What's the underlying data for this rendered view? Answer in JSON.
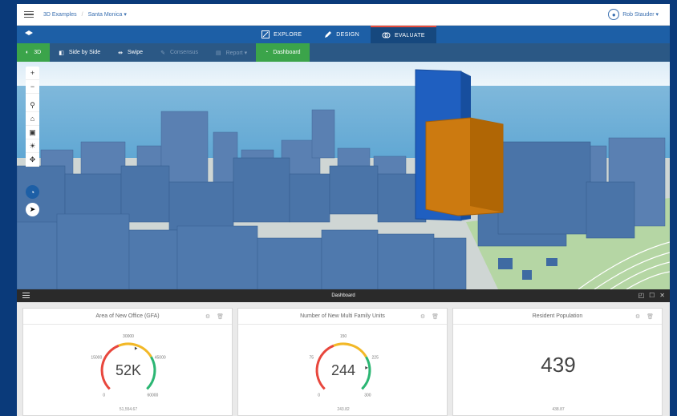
{
  "topbar": {
    "crumb_root": "3D Examples",
    "crumb_sep": "/",
    "crumb_current": "Santa Monica ▾",
    "user_name": "Rob Stauder ▾"
  },
  "nav": {
    "tabs": [
      {
        "label": "EXPLORE",
        "icon": "explore-icon"
      },
      {
        "label": "DESIGN",
        "icon": "pencil-icon"
      },
      {
        "label": "EVALUATE",
        "icon": "evaluate-icon"
      }
    ],
    "active": "EVALUATE"
  },
  "toolbar": {
    "items": [
      {
        "label": "3D",
        "icon": "globe-icon",
        "state": "active"
      },
      {
        "label": "Side by Side",
        "icon": "split-icon",
        "state": "normal"
      },
      {
        "label": "Swipe",
        "icon": "swipe-icon",
        "state": "normal"
      },
      {
        "label": "Consensus",
        "icon": "consensus-icon",
        "state": "disabled"
      },
      {
        "label": "Report ▾",
        "icon": "report-icon",
        "state": "disabled"
      },
      {
        "label": "Dashboard",
        "icon": "dashboard-icon",
        "state": "active"
      }
    ]
  },
  "map_tools": {
    "zoom_in": "+",
    "zoom_out": "−",
    "search": "⚲",
    "home": "⌂",
    "basemap": "▣",
    "daylight": "☀",
    "navigate": "✥",
    "dashboard": "◔",
    "compass": "➤"
  },
  "dashboard": {
    "title": "Dashboard",
    "window_icons": [
      "◰",
      "☐",
      "✕"
    ],
    "cards": [
      {
        "title": "Area of New Office (GFA)",
        "type": "gauge",
        "value_label": "52K",
        "value_fraction": 0.57,
        "ticks": [
          "0",
          "15000",
          "30000",
          "45000",
          "60000"
        ],
        "footer": "51,554.67"
      },
      {
        "title": "Number of New Multi Family Units",
        "type": "gauge",
        "value_label": "244",
        "value_fraction": 0.81,
        "ticks": [
          "0",
          "75",
          "150",
          "225",
          "300"
        ],
        "footer": "243.82"
      },
      {
        "title": "Resident Population",
        "type": "number",
        "value_label": "439",
        "footer": "438.87"
      }
    ]
  },
  "colors": {
    "accent": "#1d5fa6",
    "active_green": "#3ba44a",
    "highlight_orange": "#cc7a10",
    "proposed_blue": "#1f5fc0",
    "building_blue": "#4a74a8"
  }
}
